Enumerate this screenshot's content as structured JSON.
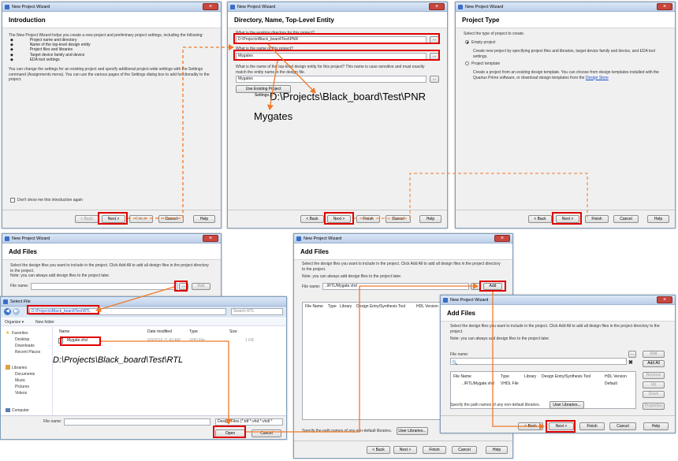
{
  "window_title": "New Project Wizard",
  "file_dialog_title": "Select File",
  "buttons": {
    "back": "< Back",
    "next": "Next >",
    "finish": "Finish",
    "cancel": "Cancel",
    "help": "Help",
    "browse": "...",
    "add": "Add",
    "add_all": "Add All",
    "remove": "Remove",
    "up": "Up",
    "down": "Down",
    "properties": "Properties",
    "user_libraries": "User Libraries...",
    "use_existing": "Use Existing Project Settings...",
    "open": "Open",
    "fd_cancel": "Cancel",
    "organize": "Organize ▾",
    "new_folder": "New folder"
  },
  "intro": {
    "heading": "Introduction",
    "description": "The New Project Wizard helps you create a new project and preliminary project settings, including the following:",
    "bullets": [
      "Project name and directory",
      "Name of the top-level design entity",
      "Project files and libraries",
      "Target device family and device",
      "EDA tool settings"
    ],
    "paragraph": "You can change the settings for an existing project and specify additional project-wide settings with the Settings command (Assignments menu). You can use the various pages of the Settings dialog box to add functionality to the project.",
    "dont_show": "Don't show me this introduction again"
  },
  "directory": {
    "heading": "Directory, Name, Top-Level Entity",
    "dir_label": "What is the working directory for this project?",
    "dir_value": "D:\\Projects\\Black_board\\Test\\PNR",
    "name_label": "What is the name of this project?",
    "name_value": "Mygates",
    "top_label": "What is the name of the top-level design entity for this project? This name is case sensitive and must exactly match the entity name in the design file.",
    "top_value": "Mygates"
  },
  "project_type": {
    "heading": "Project Type",
    "prompt": "Select the type of project to create.",
    "empty_label": "Empty project",
    "empty_desc": "Create new project by specifying project files and libraries, target device family and device, and EDA tool settings.",
    "template_label": "Project template",
    "template_desc": "Create a project from an existing design template. You can choose from design templates installed with the Quartus Prime software, or download design templates from the",
    "design_store": "Design Store"
  },
  "add_files": {
    "heading": "Add Files",
    "description": "Select the design files you want to include in the project. Click Add All to add all design files in the project directory to the project.",
    "note": "Note: you can always add design files to the project later.",
    "file_name_label": "File name:",
    "file_value": "../RTL/Mygate.vhd",
    "columns": [
      "File Name",
      "Type",
      "Library",
      "Design Entry/Synthesis Tool",
      "HDL Version"
    ],
    "row": {
      "file": "../RTL/Mygate.vhd",
      "type": "VHDL File",
      "hdl": "Default"
    },
    "user_lib_note": "Specify the path names of any non-default libraries."
  },
  "file_dialog": {
    "path": "D:\\Projects\\Black_board\\Test\\RTL",
    "search_placeholder": "Search RTL",
    "nav_items": [
      "Favorites",
      "Desktop",
      "Downloads",
      "Recent Places",
      "Libraries",
      "Documents",
      "Music",
      "Pictures",
      "Videos",
      "Computer"
    ],
    "columns": [
      "Name",
      "Date modified",
      "Type",
      "Size"
    ],
    "file": {
      "name": "Mygate.vhd",
      "date": "6/9/2016 11:43 AM",
      "type": "VHD File",
      "size": "1 KB"
    },
    "file_name_label": "File name:",
    "filter": "Design Files (*.tdf *.vhd *.vhdl *"
  },
  "annotations": {
    "pnr_path": "D:\\Projects\\Black_board\\Test\\PNR",
    "name": "Mygates",
    "rtl_path": "D:\\Projects\\Black_board\\Test\\RTL"
  },
  "colors": {
    "highlight": "#e00000",
    "arrow": "#f07828",
    "link": "#1a4fc9"
  }
}
